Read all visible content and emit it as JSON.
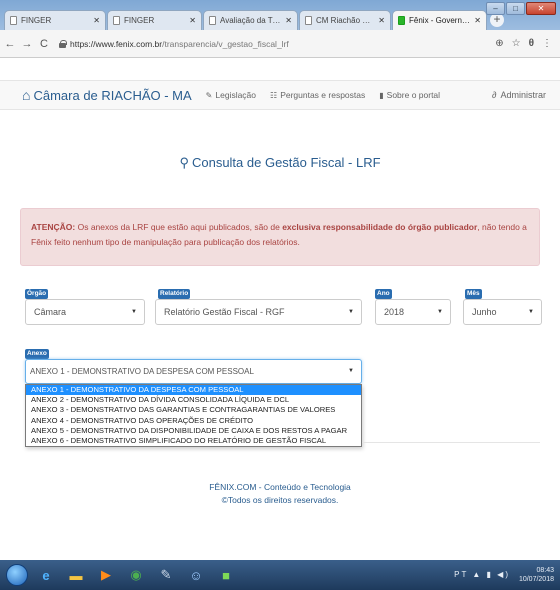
{
  "browser": {
    "tabs": [
      {
        "label": "FINGER",
        "active": false
      },
      {
        "label": "FINGER",
        "active": false
      },
      {
        "label": "Avaliação da Transparência do",
        "active": false
      },
      {
        "label": "CM Riachão – Câmara Municip",
        "active": false
      },
      {
        "label": "Fênix - Governo Transparente",
        "active": true
      }
    ],
    "url_host": "https://www.fenix.com.br",
    "url_path": "/transparencia/v_gestao_fiscal_lrf"
  },
  "nav": {
    "brand": "Câmara de RIACHÃO - MA",
    "links": [
      "Legislação",
      "Perguntas e respostas",
      "Sobre o portal"
    ],
    "admin": "Administrar"
  },
  "page": {
    "heading": "Consulta de Gestão Fiscal - LRF",
    "alert": {
      "prefix": "ATENÇÃO:",
      "text1": " Os anexos da LRF que estão aqui publicados, são de ",
      "bold": "exclusiva responsabilidade do órgão publicador",
      "text2": ", não tendo a Fênix feito nenhum tipo de manipulação para publicação dos relatórios."
    }
  },
  "form": {
    "orgao": {
      "label": "Órgão",
      "value": "Câmara"
    },
    "relatorio": {
      "label": "Relatório",
      "value": "Relatório Gestão Fiscal - RGF"
    },
    "ano": {
      "label": "Ano",
      "value": "2018"
    },
    "mes": {
      "label": "Mês",
      "value": "Junho"
    },
    "anexo": {
      "label": "Anexo",
      "value": "ANEXO 1 - DEMONSTRATIVO DA DESPESA COM PESSOAL",
      "options": [
        "ANEXO 1 - DEMONSTRATIVO DA DESPESA COM PESSOAL",
        "ANEXO 2 - DEMONSTRATIVO DA DÍVIDA CONSOLIDADA LÍQUIDA E DCL",
        "ANEXO 3 - DEMONSTRATIVO DAS GARANTIAS E CONTRAGARANTIAS DE VALORES",
        "ANEXO 4 - DEMONSTRATIVO DAS OPERAÇÕES DE CRÉDITO",
        "ANEXO 5 - DEMONSTRATIVO DA DISPONIBILIDADE DE CAIXA E DOS RESTOS A PAGAR",
        "ANEXO 6 - DEMONSTRATIVO SIMPLIFICADO DO RELATÓRIO DE GESTÃO FISCAL"
      ],
      "selected_index": 0
    }
  },
  "footer": {
    "line1": "FÊNIX.COM - Conteúdo e Tecnologia",
    "line2": "©Todos os direitos reservados."
  },
  "taskbar": {
    "lang": "PT",
    "time": "08:43",
    "date": "10/07/2018"
  },
  "colors": {
    "primary": "#2a5d8f",
    "label_bg": "#2a6db0",
    "alert_bg": "#f2dede",
    "alert_text": "#a94442",
    "selected_option": "#1e90ff"
  }
}
